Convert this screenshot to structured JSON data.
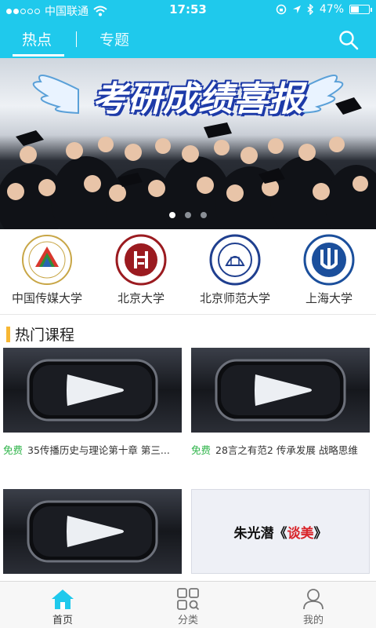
{
  "status": {
    "carrier": "中国联通",
    "time": "17:53",
    "battery": "47%",
    "battery_level": 0.47
  },
  "header": {
    "tabs": [
      {
        "label": "热点"
      },
      {
        "label": "专题"
      }
    ]
  },
  "banner": {
    "title": "考研成绩喜报"
  },
  "universities": [
    {
      "name": "中国传媒大学",
      "logo": "cuc-logo"
    },
    {
      "name": "北京大学",
      "logo": "pku-logo"
    },
    {
      "name": "北京师范大学",
      "logo": "bnu-logo"
    },
    {
      "name": "上海大学",
      "logo": "shu-logo"
    }
  ],
  "section": {
    "title": "热门课程"
  },
  "courses": [
    {
      "tag": "免费",
      "title": "35传播历史与理论第十章 第三..."
    },
    {
      "tag": "免费",
      "title": "28言之有范2 传承发展 战略思维"
    },
    {
      "tag": "",
      "title": ""
    },
    {
      "thumb_title_a": "朱光潜《",
      "thumb_title_b": "谈美",
      "thumb_title_c": "》"
    }
  ],
  "nav": [
    {
      "label": "首页",
      "icon": "home-icon"
    },
    {
      "label": "分类",
      "icon": "category-icon"
    },
    {
      "label": "我的",
      "icon": "profile-icon"
    }
  ],
  "colors": {
    "accent": "#1fc9ec",
    "free": "#2fb44a",
    "section_bar": "#f7b733"
  }
}
